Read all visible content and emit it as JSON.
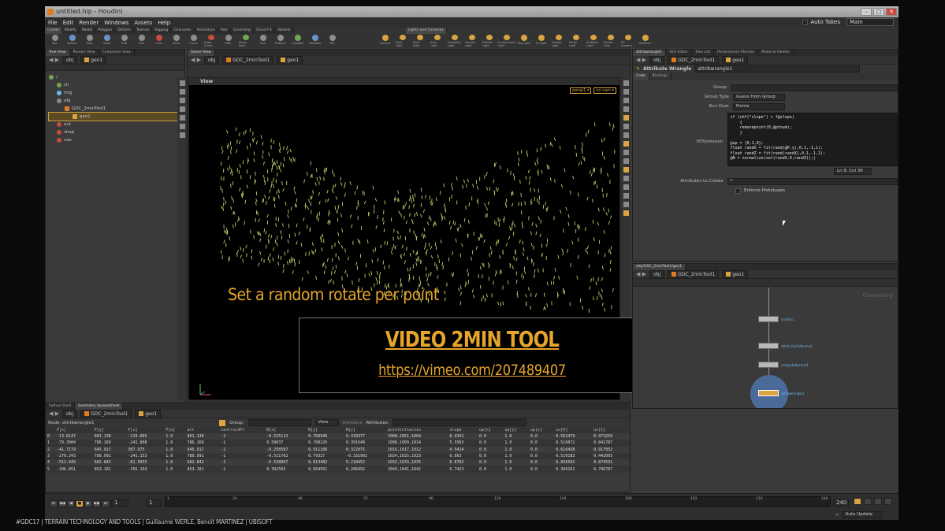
{
  "window": {
    "title": "untitled.hip - Houdini"
  },
  "menu": [
    "File",
    "Edit",
    "Render",
    "Windows",
    "Assets",
    "Help"
  ],
  "menu_right": {
    "auto_takes": "Auto Takes",
    "take": "Main"
  },
  "shelf": {
    "tabs": [
      "Create",
      "Modify",
      "Model",
      "Polygon",
      "Deform",
      "Texture",
      "Rigging",
      "Character",
      "Animation",
      "Hair",
      "Grooming",
      "Cloud FX",
      "Volume"
    ],
    "tools": [
      "Box",
      "Sphere",
      "Tube",
      "Torus",
      "Grid",
      "Null",
      "Line",
      "Circle",
      "Curve",
      "Draw Curve",
      "Path",
      "Spray Paint",
      "Font",
      "Platonic",
      "L-System",
      "Metaball",
      "File"
    ],
    "light_tabs": [
      "Lights and Cameras"
    ],
    "light_tools": [
      "Camera",
      "Point Light",
      "Spot Light",
      "Area Light",
      "Geometry Light",
      "Volume Light",
      "Distant Light",
      "Environment Light",
      "Sky Light",
      "GI Light",
      "Caustic Light",
      "Portal Light",
      "Ambient Light",
      "Stereo Cam",
      "VR Camera",
      "Switcher"
    ]
  },
  "left_pane": {
    "tabs": [
      "Tree View",
      "Render View",
      "Composite View"
    ],
    "path": [
      "obj",
      "geo1"
    ],
    "tree": [
      "/",
      "ch",
      "img",
      "obj",
      "GDC_2minTool1",
      "geo1",
      "out",
      "shop",
      "vex"
    ]
  },
  "viewport": {
    "tabs": [
      "Scene View"
    ],
    "path": [
      "obj",
      "GDC_2minTool1",
      "geo1"
    ],
    "label": "View",
    "persp": "persp1 ▾",
    "cam": "no cam ▾",
    "caption": "Set a random rotate per point",
    "banner_title": "VIDEO 2MIN TOOL",
    "banner_url": "https://vimeo.com/207489407"
  },
  "params": {
    "tabs": [
      "attribwrangle1",
      "VEX Editor",
      "Take List",
      "Performance Monitor",
      "Material Palette"
    ],
    "path": [
      "obj",
      "GDC_2minTool1",
      "geo1"
    ],
    "node_type": "Attribute Wrangle",
    "node_name": "attribwrangle1",
    "subtabs": [
      "Code",
      "Bindings"
    ],
    "group_label": "Group",
    "group_value": "",
    "group_type_label": "Group Type",
    "group_type_value": "Guess from Group",
    "run_over_label": "Run Over",
    "run_over_value": "Points",
    "vex_label": "VEXpression",
    "vex_lines": [
      "if (chf(\"slope\") > f@slope)",
      "    {",
      "    removepoint(0,@ptnum);",
      "    }",
      "",
      "@up = {0,1,0};",
      "float randX = fit(rand(@P.y),0,1,-1,1);",
      "float randZ = fit(rand(randX),0,1,-1,1);",
      "@N = normalize(set(randX,0,randZ));|"
    ],
    "cursor_pos": "Ln 9, Col 36",
    "attrs_label": "Attributes to Create",
    "attrs_value": "*",
    "enforce_label": "Enforce Prototypes"
  },
  "network": {
    "tabs": [
      "/obj/GDC_2minTool1/geo1"
    ],
    "path": [
      "obj",
      "GDC_2minTool1",
      "geo1"
    ],
    "corner_label": "Geometry",
    "nodes": [
      "scatter1",
      "attrib_fromVolume1",
      "computeNormal1",
      "attribwrangle1"
    ]
  },
  "spreadsheet": {
    "tabs": [
      "Python Shell",
      "Geometry Spreadsheet"
    ],
    "path": [
      "obj",
      "GDC_2minTool1",
      "geo1"
    ],
    "node_label": "Node: attribwrangle1",
    "group_label": "Group:",
    "view_label": "View",
    "intrinsics": "Intrinsics",
    "attributes": "Attributes:",
    "columns": [
      "",
      "P[x]",
      "P[y]",
      "P[z]",
      "P[w]",
      "alt",
      "centroidPt",
      "N[x]",
      "N[y]",
      "N[z]",
      "pointCollectio",
      "slope",
      "up[x]",
      "up[y]",
      "up[z]",
      "uv[0]",
      "uv[1]"
    ],
    "rows": [
      [
        "0",
        "-13.6147",
        "801.138",
        "-219.005",
        "1.0",
        "801.138",
        "-1",
        "-0.525113",
        "0.769946",
        "0.339377",
        "1008,1061,1004",
        "8.4341",
        "0.0",
        "1.0",
        "0.0",
        "0.562479",
        "0.973259"
      ],
      [
        "1",
        "-79.3904",
        "786.169",
        "-241.808",
        "1.0",
        "786.169",
        "-1",
        "0.59637",
        "0.708226",
        "0.391648",
        "1008,1009,1014",
        "5.5993",
        "0.0",
        "1.0",
        "0.0",
        "0.516872",
        "0.841787"
      ],
      [
        "2",
        "-41.7179",
        "645.917",
        "307.975",
        "1.0",
        "645.917",
        "-1",
        "-0.258587",
        "0.911106",
        "0.322875",
        "1016,1017,1012",
        "4.5414",
        "0.0",
        "1.0",
        "0.0",
        "0.616438",
        "0.917052"
      ],
      [
        "3",
        "-270.243",
        "780.991",
        "-241.153",
        "1.0",
        "780.991",
        "-1",
        "-0.511762",
        "0.79327",
        "-0.331902",
        "1024,1025,1023",
        "0.863",
        "0.0",
        "1.0",
        "0.0",
        "0.510183",
        "0.442003"
      ],
      [
        "4",
        "-512.949",
        "682.842",
        "-81.9933",
        "1.0",
        "682.842",
        "-1",
        "-0.538807",
        "0.813482",
        "0.218452",
        "1032,1033,1035",
        "6.8782",
        "0.0",
        "1.0",
        "0.0",
        "0.836502",
        "0.874591"
      ],
      [
        "5",
        "-106.851",
        "853.181",
        "-356.164",
        "1.0",
        "853.181",
        "-1",
        "0.392503",
        "0.894561",
        "0.206492",
        "1040,1041,1042",
        "6.7423",
        "0.0",
        "1.0",
        "0.0",
        "0.300161",
        "0.706787"
      ]
    ]
  },
  "timeline": {
    "frame": "1",
    "start": "1",
    "end": "240",
    "ticks": [
      "1",
      "24",
      "48",
      "72",
      "96",
      "120",
      "144",
      "168",
      "192",
      "216",
      "240"
    ],
    "auto_update": "Auto Update"
  },
  "footer": "#GDC17 | TERRAIN TECHNOLOGY AND TOOLS | Guillaume WERLE, Benoit MARTINEZ | UBISOFT",
  "colors": {
    "accent": "#e6a52a",
    "houdini_orange": "#e07b20"
  }
}
